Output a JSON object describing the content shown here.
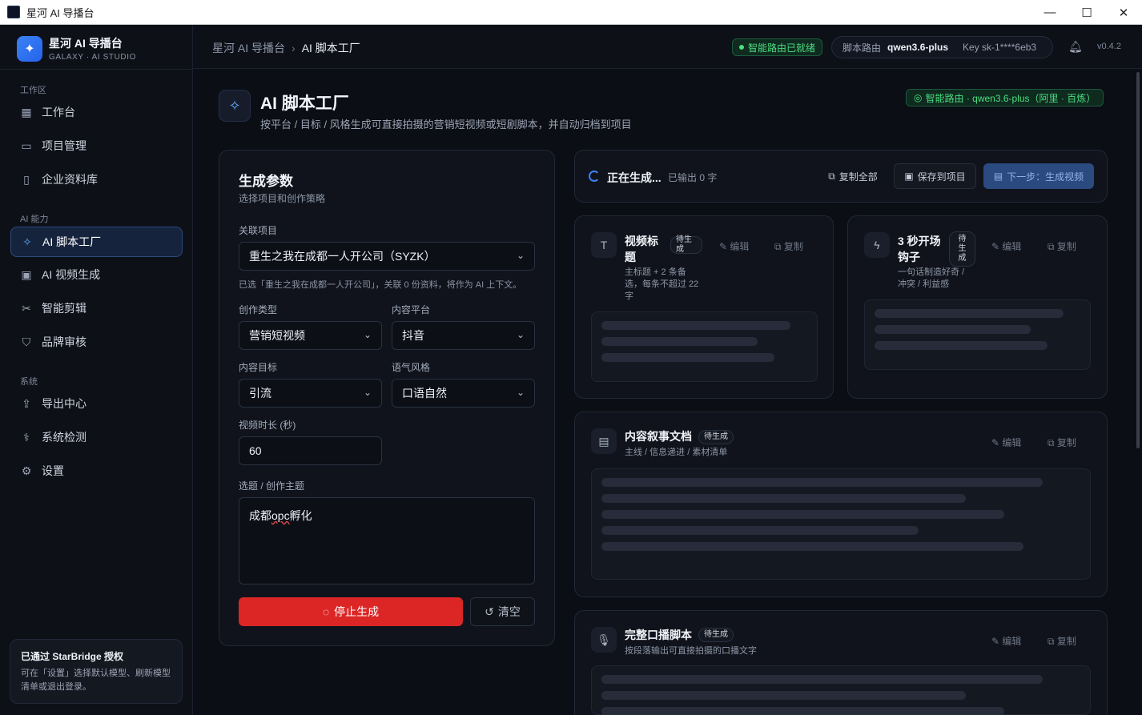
{
  "window": {
    "title": "星河 AI 导播台",
    "controls": [
      "—",
      "☐",
      "✕"
    ]
  },
  "brand": {
    "name": "星河 AI 导播台",
    "subtitle": "GALAXY · AI STUDIO"
  },
  "sidebar": {
    "sections": [
      {
        "label": "工作区",
        "items": [
          {
            "label": "工作台",
            "icon": "grid-icon"
          },
          {
            "label": "项目管理",
            "icon": "folder-icon"
          },
          {
            "label": "企业资料库",
            "icon": "book-icon"
          }
        ]
      },
      {
        "label": "AI 能力",
        "items": [
          {
            "label": "AI 脚本工厂",
            "icon": "sparkle-icon",
            "active": true
          },
          {
            "label": "AI 视频生成",
            "icon": "clapper-icon"
          },
          {
            "label": "智能剪辑",
            "icon": "scissors-icon"
          },
          {
            "label": "品牌审核",
            "icon": "shield-icon"
          }
        ]
      },
      {
        "label": "系统",
        "items": [
          {
            "label": "导出中心",
            "icon": "upload-icon"
          },
          {
            "label": "系统检测",
            "icon": "stethoscope-icon"
          },
          {
            "label": "设置",
            "icon": "gear-icon"
          }
        ]
      }
    ],
    "auth_card": {
      "title": "已通过 StarBridge 授权",
      "desc": "可在「设置」选择默认模型、刷新模型清单或退出登录。"
    }
  },
  "header": {
    "breadcrumb": [
      "星河 AI 导播台",
      "AI 脚本工厂"
    ],
    "status_badge": "智能路由已就绪",
    "route_label": "脚本路由",
    "route_model": "qwen3.6-plus",
    "key_label": "Key sk-1****6eb3",
    "version": "v0.4.2"
  },
  "page": {
    "title": "AI 脚本工厂",
    "subtitle": "按平台 / 目标 / 风格生成可直接拍摄的营销短视频或短剧脚本，并自动归档到项目",
    "route_badge": "智能路由 · qwen3.6-plus（阿里 · 百炼）"
  },
  "form": {
    "title": "生成参数",
    "subtitle": "选择项目和创作策略",
    "project_label": "关联项目",
    "project_value": "重生之我在成都一人开公司（SYZK）",
    "project_hint": "已选「重生之我在成都一人开公司」，关联 0 份资料，将作为 AI 上下文。",
    "type_label": "创作类型",
    "type_value": "营销短视频",
    "platform_label": "内容平台",
    "platform_value": "抖音",
    "goal_label": "内容目标",
    "goal_value": "引流",
    "tone_label": "语气风格",
    "tone_value": "口语自然",
    "duration_label": "视频时长 (秒)",
    "duration_value": "60",
    "topic_label": "选题 / 创作主题",
    "topic_value_a": "成都",
    "topic_value_b": "opc",
    "topic_value_c": "孵化",
    "stop_button": "停止生成",
    "clear_button": "清空"
  },
  "output": {
    "status": "正在生成...",
    "count": "已输出 0 字",
    "copy_all": "复制全部",
    "save": "保存到项目",
    "next": "下一步：生成视频",
    "edit": "编辑",
    "copy": "复制",
    "sections": {
      "title_sec": {
        "title_l1": "视频标",
        "title_l2": "题",
        "pill_l1": "待生",
        "pill_l2": "成",
        "desc_l1": "主标题 + 2 条备",
        "desc_l2": "选，每条不超过 22",
        "desc_l3": "字"
      },
      "hook_sec": {
        "title_l1": "3 秒开场",
        "title_l2": "钩子",
        "pill_l1": "待",
        "pill_l2": "生",
        "pill_l3": "成",
        "desc_l1": "一句话制造好奇 /",
        "desc_l2": "冲突 / 利益感"
      },
      "narrative_sec": {
        "title": "内容叙事文档",
        "pill": "待生成",
        "desc": "主线 / 信息递进 / 素材清单"
      },
      "script_sec": {
        "title": "完整口播脚本",
        "pill": "待生成",
        "desc": "按段落输出可直接拍摄的口播文字"
      }
    }
  },
  "colors": {
    "accent": "#3b82f6",
    "success": "#4ade80",
    "danger": "#dc2626",
    "bg": "#0b0e14"
  }
}
